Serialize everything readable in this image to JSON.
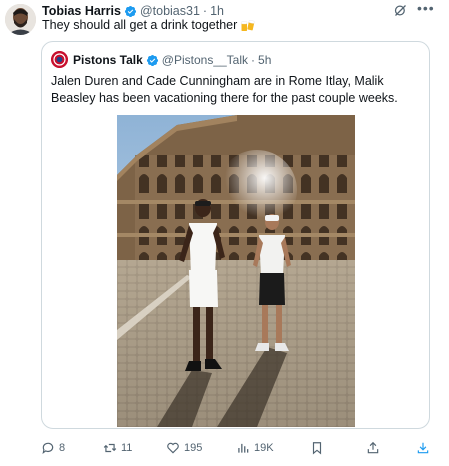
{
  "author": {
    "name": "Tobias Harris",
    "handle": "@tobias31",
    "separator": "·",
    "time": "1h"
  },
  "tweet": {
    "text": "They should all get a drink together"
  },
  "quoted": {
    "name": "Pistons Talk",
    "handle": "@Pistons__Talk",
    "separator": "·",
    "time": "5h",
    "text": "Jalen Duren and Cade Cunningham are in Rome Itlay, Malik Beasley has been vacationing there for the past couple weeks."
  },
  "actions": {
    "replies": "8",
    "retweets": "11",
    "likes": "195",
    "views": "19K"
  },
  "colors": {
    "verified": "#1d9bf0",
    "muted": "#536471",
    "border": "#cfd9de",
    "pistons_red": "#c8102e"
  },
  "icons": [
    "verified-icon",
    "grok-icon",
    "more-icon",
    "beer-icon",
    "reply-icon",
    "retweet-icon",
    "like-icon",
    "views-icon",
    "bookmark-icon",
    "share-icon",
    "download-icon"
  ]
}
